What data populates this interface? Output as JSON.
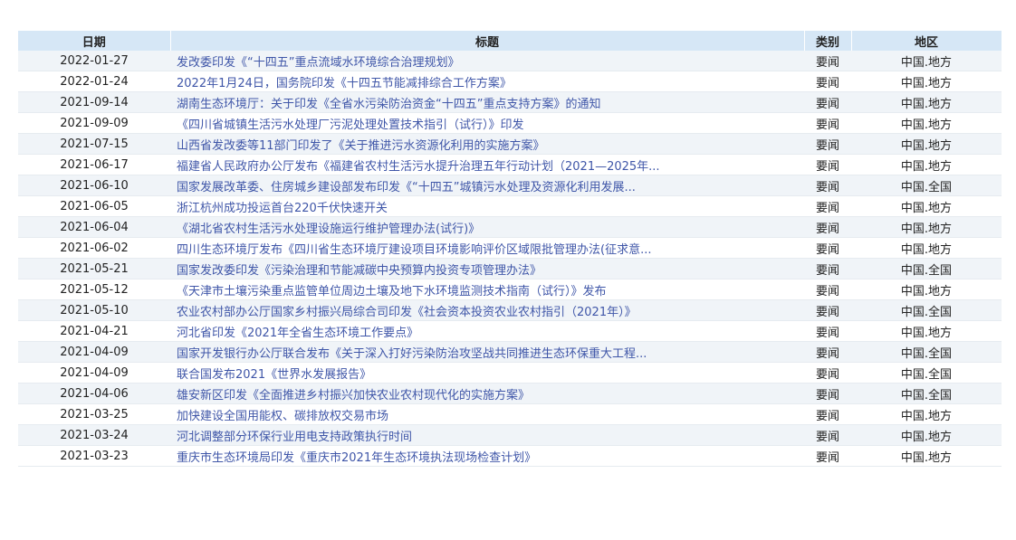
{
  "table": {
    "headers": [
      "日期",
      "标题",
      "类别",
      "地区"
    ],
    "rows": [
      {
        "date": "2022-01-27",
        "title": "发改委印发《“十四五”重点流域水环境综合治理规划》",
        "category": "要闻",
        "region": "中国.地方"
      },
      {
        "date": "2022-01-24",
        "title": "2022年1月24日，国务院印发《十四五节能减排综合工作方案》",
        "category": "要闻",
        "region": "中国.地方"
      },
      {
        "date": "2021-09-14",
        "title": "湖南生态环境厅：关于印发《全省水污染防治资金“十四五”重点支持方案》的通知",
        "category": "要闻",
        "region": "中国.地方"
      },
      {
        "date": "2021-09-09",
        "title": "《四川省城镇生活污水处理厂污泥处理处置技术指引（试行）》印发",
        "category": "要闻",
        "region": "中国.地方"
      },
      {
        "date": "2021-07-15",
        "title": "山西省发改委等11部门印发了《关于推进污水资源化利用的实施方案》",
        "category": "要闻",
        "region": "中国.地方"
      },
      {
        "date": "2021-06-17",
        "title": "福建省人民政府办公厅发布《福建省农村生活污水提升治理五年行动计划（2021—2025年...",
        "category": "要闻",
        "region": "中国.地方"
      },
      {
        "date": "2021-06-10",
        "title": "国家发展改革委、住房城乡建设部发布印发《“十四五”城镇污水处理及资源化利用发展...",
        "category": "要闻",
        "region": "中国.全国"
      },
      {
        "date": "2021-06-05",
        "title": "浙江杭州成功投运首台220千伏快速开关",
        "category": "要闻",
        "region": "中国.地方"
      },
      {
        "date": "2021-06-04",
        "title": "《湖北省农村生活污水处理设施运行维护管理办法(试行)》",
        "category": "要闻",
        "region": "中国.地方"
      },
      {
        "date": "2021-06-02",
        "title": "四川生态环境厅发布《四川省生态环境厅建设项目环境影响评价区域限批管理办法(征求意...",
        "category": "要闻",
        "region": "中国.地方"
      },
      {
        "date": "2021-05-21",
        "title": "国家发改委印发《污染治理和节能减碳中央预算内投资专项管理办法》",
        "category": "要闻",
        "region": "中国.全国"
      },
      {
        "date": "2021-05-12",
        "title": "《天津市土壤污染重点监管单位周边土壤及地下水环境监测技术指南（试行）》发布",
        "category": "要闻",
        "region": "中国.地方"
      },
      {
        "date": "2021-05-10",
        "title": "农业农村部办公厅国家乡村振兴局综合司印发《社会资本投资农业农村指引（2021年）》",
        "category": "要闻",
        "region": "中国.全国"
      },
      {
        "date": "2021-04-21",
        "title": "河北省印发《2021年全省生态环境工作要点》",
        "category": "要闻",
        "region": "中国.地方"
      },
      {
        "date": "2021-04-09",
        "title": "国家开发银行办公厅联合发布《关于深入打好污染防治攻坚战共同推进生态环保重大工程...",
        "category": "要闻",
        "region": "中国.全国"
      },
      {
        "date": "2021-04-09",
        "title": "联合国发布2021《世界水发展报告》",
        "category": "要闻",
        "region": "中国.全国"
      },
      {
        "date": "2021-04-06",
        "title": "雄安新区印发《全面推进乡村振兴加快农业农村现代化的实施方案》",
        "category": "要闻",
        "region": "中国.全国"
      },
      {
        "date": "2021-03-25",
        "title": "加快建设全国用能权、碳排放权交易市场",
        "category": "要闻",
        "region": "中国.地方"
      },
      {
        "date": "2021-03-24",
        "title": "河北调整部分环保行业用电支持政策执行时间",
        "category": "要闻",
        "region": "中国.地方"
      },
      {
        "date": "2021-03-23",
        "title": "重庆市生态环境局印发《重庆市2021年生态环境执法现场检查计划》",
        "category": "要闻",
        "region": "中国.地方"
      }
    ]
  },
  "colors": {
    "header_bg": "#d6e7f6",
    "row_alt_bg": "#f0f4f8",
    "link": "#3f56a8"
  }
}
